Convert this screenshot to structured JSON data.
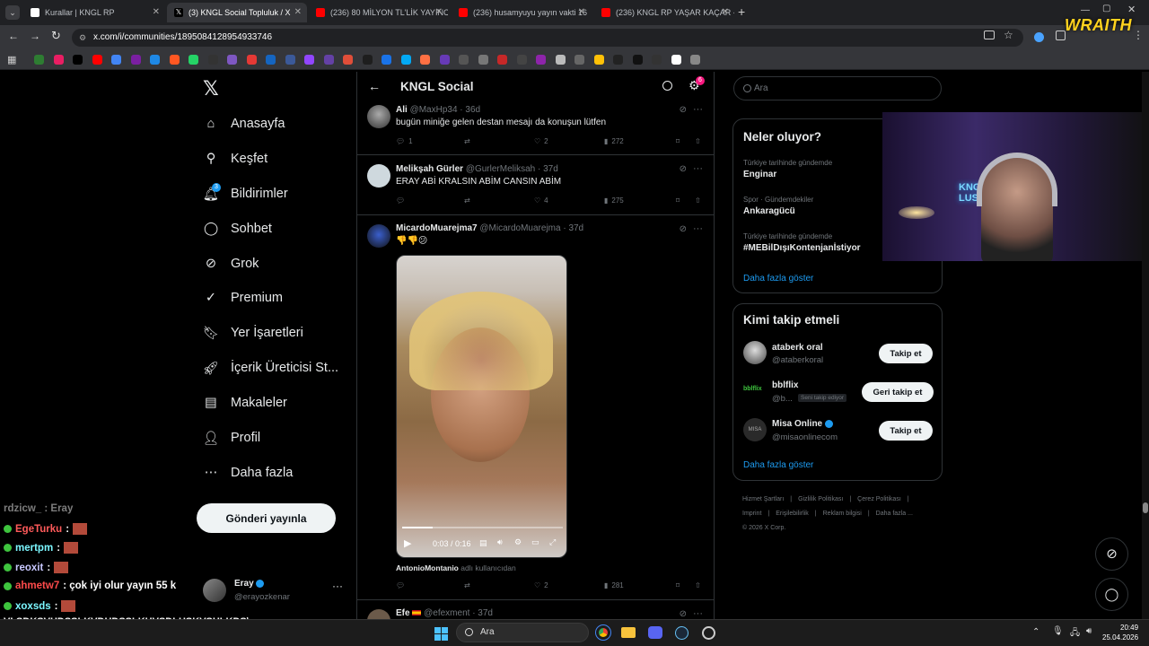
{
  "browser": {
    "tabs": [
      {
        "label": "Kurallar | KNGL RP"
      },
      {
        "label": "(3) KNGL Social Topluluk / X"
      },
      {
        "label": "(236) 80 MİLYON TL'LİK YAYINC"
      },
      {
        "label": "(236) husamyuyu yayın vakti 16"
      },
      {
        "label": "(236) KNGL RP YAŞAR KAÇAR -"
      }
    ],
    "new_tab": "+",
    "url": "x.com/i/communities/1895084128954933746"
  },
  "nav": {
    "items": [
      {
        "label": "Anasayfa",
        "icon": "home-icon"
      },
      {
        "label": "Keşfet",
        "icon": "search-icon"
      },
      {
        "label": "Bildirimler",
        "icon": "bell-icon",
        "badge": "3"
      },
      {
        "label": "Sohbet",
        "icon": "chat-icon"
      },
      {
        "label": "Grok",
        "icon": "grok-icon"
      },
      {
        "label": "Premium",
        "icon": "premium-icon"
      },
      {
        "label": "Yer İşaretleri",
        "icon": "bookmark-icon"
      },
      {
        "label": "İçerik Üreticisi St...",
        "icon": "rocket-icon"
      },
      {
        "label": "Makaleler",
        "icon": "article-icon"
      },
      {
        "label": "Profil",
        "icon": "person-icon"
      },
      {
        "label": "Daha fazla",
        "icon": "more-circle-icon"
      }
    ],
    "post_button": "Gönderi yayınla",
    "account": {
      "name": "Eray",
      "handle": "@erayozkenar"
    }
  },
  "feed": {
    "title": "KNGL Social",
    "settings_badge": "6",
    "posts": [
      {
        "name": "Ali",
        "handle": "@MaxHp34 · 36d",
        "text": "bugün miniğe gelen destan mesajı da konuşun lütfen",
        "replies": "1",
        "reposts": "",
        "likes": "2",
        "views": "272"
      },
      {
        "name": "Melikşah Gürler",
        "handle": "@GurlerMeliksah · 37d",
        "text": "ERAY ABİ KRALSIN ABİM CANSIN ABİM",
        "replies": "",
        "reposts": "",
        "likes": "4",
        "views": "275"
      },
      {
        "name": "MicardoMuarejma7",
        "handle": "@MicardoMuarejma · 37d",
        "text": "👎👎😕",
        "video_time": "0:03 / 0:16",
        "video_progress": 0.19,
        "caption_user": "AntonioMontanio",
        "caption_rest": "adlı kullanıcıdan",
        "replies": "",
        "reposts": "",
        "likes": "2",
        "views": "281"
      },
      {
        "name": "Efe",
        "handle": "@efexment · 37d"
      }
    ]
  },
  "search": {
    "placeholder": "Ara"
  },
  "trends": {
    "title": "Neler oluyor?",
    "items": [
      {
        "context": "Türkiye tarihinde gündemde",
        "name": "Enginar"
      },
      {
        "context": "Spor · Gündemdekiler",
        "name": "Ankaragücü"
      },
      {
        "context": "Türkiye tarihinde gündemde",
        "name": "#MEBilDışıKontenjanİstiyor"
      }
    ],
    "show_more": "Daha fazla göster"
  },
  "who_to_follow": {
    "title": "Kimi takip etmeli",
    "items": [
      {
        "name": "ataberk oral",
        "handle": "@ataberkoral",
        "button": "Takip et"
      },
      {
        "name": "bblflix",
        "handle": "@b...",
        "badge": "Seni takip ediyor",
        "button": "Geri takip et",
        "avatar_text": "bblflix"
      },
      {
        "name": "Misa Online",
        "handle": "@misaonlinecom",
        "button": "Takip et",
        "avatar_text": "MISA"
      }
    ],
    "show_more": "Daha fazla göster"
  },
  "footer": {
    "links": [
      "Hizmet Şartları",
      "|",
      "Gizlilik Politikası",
      "|",
      "Çerez Politikası",
      "|",
      "Imprint",
      "|",
      "Erişilebilirlik",
      "|",
      "Reklam bilgisi",
      "|",
      "Daha fazla ...",
      "© 2026 X Corp."
    ]
  },
  "overlay": {
    "brand": "WRAITH",
    "webcam_sign": "KNG LUS",
    "chat": [
      {
        "user": "EgeTurku",
        "msg": ":",
        "color": "#ff5a5a"
      },
      {
        "user": "mertpm",
        "msg": ":",
        "color": "#7cf7ff"
      },
      {
        "user": "reoxit",
        "msg": ":",
        "color": "#c8c8ff"
      },
      {
        "user": "ahmetw7",
        "msg": ": çok iyi olur yayın 55 k",
        "color": "#ff4b4b"
      },
      {
        "user": "xoxsds",
        "msg": ":",
        "color": "#7cf7ff"
      }
    ],
    "spam1": "VLSDKŞVHDSŞLKVDHDSŞLKHVŞDLHSKVŞHLKDS\\",
    "spam2": "DSŞHKVLŞDSLŞKHVSDKHVDKLHVŞHLKDSLKVDSI",
    "partial_top": "rdzicw_ : Eray"
  },
  "taskbar": {
    "search": "Ara",
    "time": "20:49",
    "date": "25.04.2026"
  }
}
